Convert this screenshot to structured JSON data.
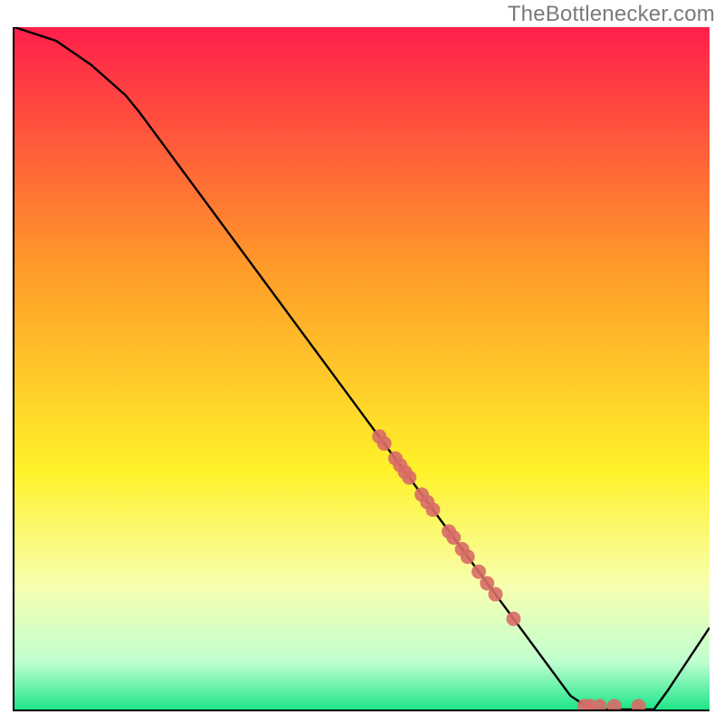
{
  "watermark": "TheBottlenecker.com",
  "chart_data": {
    "type": "line",
    "title": "",
    "xlabel": "",
    "ylabel": "",
    "xlim": [
      0,
      100
    ],
    "ylim": [
      0,
      100
    ],
    "grid": false,
    "background_gradient": {
      "type": "vertical",
      "stops": [
        {
          "pct": 0,
          "color": "#ff1f4b"
        },
        {
          "pct": 35,
          "color": "#ff9a29"
        },
        {
          "pct": 65,
          "color": "#fff22a"
        },
        {
          "pct": 82,
          "color": "#f7ffb0"
        },
        {
          "pct": 93,
          "color": "#c0ffd0"
        },
        {
          "pct": 100,
          "color": "#1ee58a"
        }
      ]
    },
    "series": [
      {
        "name": "bottleneck-curve",
        "color": "#000000",
        "x": [
          0,
          6,
          11,
          16,
          18,
          80,
          83,
          92,
          94,
          100
        ],
        "y": [
          100,
          98,
          94.5,
          90,
          87.5,
          2,
          0,
          0,
          2.8,
          12
        ]
      }
    ],
    "scatter": [
      {
        "name": "points-on-curve",
        "color": "#d86b66",
        "radius": 8,
        "points": [
          {
            "x": 52.5,
            "y": 40
          },
          {
            "x": 53.2,
            "y": 39
          },
          {
            "x": 54.8,
            "y": 36.8
          },
          {
            "x": 55.5,
            "y": 35.8
          },
          {
            "x": 56.2,
            "y": 34.8
          },
          {
            "x": 56.8,
            "y": 34
          },
          {
            "x": 58.6,
            "y": 31.5
          },
          {
            "x": 59.4,
            "y": 30.4
          },
          {
            "x": 60.2,
            "y": 29.3
          },
          {
            "x": 62.5,
            "y": 26.1
          },
          {
            "x": 63.2,
            "y": 25.2
          },
          {
            "x": 64.4,
            "y": 23.5
          },
          {
            "x": 65.2,
            "y": 22.4
          },
          {
            "x": 66.8,
            "y": 20.2
          },
          {
            "x": 68.0,
            "y": 18.5
          },
          {
            "x": 69.2,
            "y": 16.9
          },
          {
            "x": 71.8,
            "y": 13.3
          },
          {
            "x": 82.0,
            "y": 0.5
          },
          {
            "x": 82.8,
            "y": 0.5
          },
          {
            "x": 84.2,
            "y": 0.5
          },
          {
            "x": 86.3,
            "y": 0.5
          },
          {
            "x": 89.8,
            "y": 0.5
          }
        ]
      }
    ]
  }
}
